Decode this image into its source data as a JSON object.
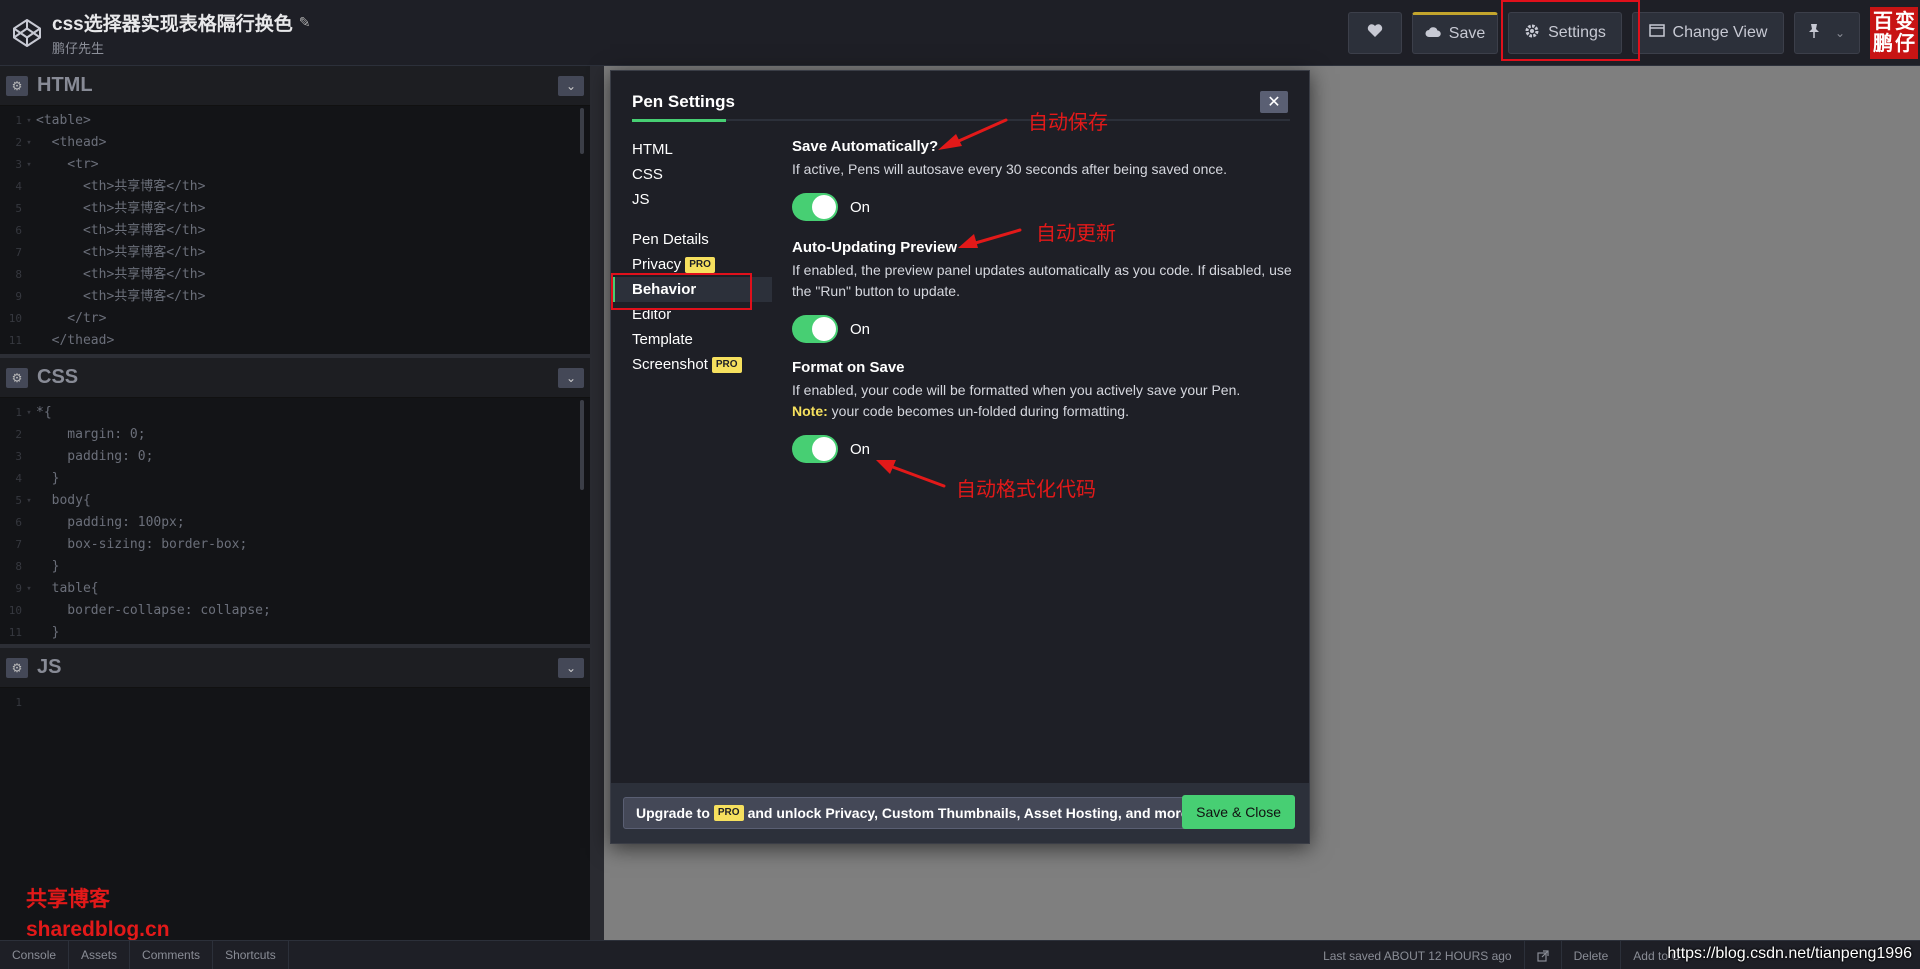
{
  "header": {
    "pen_title": "css选择器实现表格隔行换色",
    "author": "鹏仔先生",
    "save_label": "Save",
    "settings_label": "Settings",
    "change_view_label": "Change View",
    "avatar_chars": [
      "百",
      "变",
      "鹏",
      "仔"
    ]
  },
  "editors": {
    "html": {
      "label": "HTML",
      "lines": [
        {
          "n": "1",
          "fold": "▾",
          "text": "<table>"
        },
        {
          "n": "2",
          "fold": "▾",
          "text": "  <thead>"
        },
        {
          "n": "3",
          "fold": "▾",
          "text": "    <tr>"
        },
        {
          "n": "4",
          "fold": "",
          "text": "      <th>共享博客</th>"
        },
        {
          "n": "5",
          "fold": "",
          "text": "      <th>共享博客</th>"
        },
        {
          "n": "6",
          "fold": "",
          "text": "      <th>共享博客</th>"
        },
        {
          "n": "7",
          "fold": "",
          "text": "      <th>共享博客</th>"
        },
        {
          "n": "8",
          "fold": "",
          "text": "      <th>共享博客</th>"
        },
        {
          "n": "9",
          "fold": "",
          "text": "      <th>共享博客</th>"
        },
        {
          "n": "10",
          "fold": "",
          "text": "    </tr>"
        },
        {
          "n": "11",
          "fold": "",
          "text": "  </thead>"
        }
      ]
    },
    "css": {
      "label": "CSS",
      "lines": [
        {
          "n": "1",
          "fold": "▾",
          "text": "*{"
        },
        {
          "n": "2",
          "fold": "",
          "text": "    margin: 0;"
        },
        {
          "n": "3",
          "fold": "",
          "text": "    padding: 0;"
        },
        {
          "n": "4",
          "fold": "",
          "text": "  }"
        },
        {
          "n": "5",
          "fold": "▾",
          "text": "  body{"
        },
        {
          "n": "6",
          "fold": "",
          "text": "    padding: 100px;"
        },
        {
          "n": "7",
          "fold": "",
          "text": "    box-sizing: border-box;"
        },
        {
          "n": "8",
          "fold": "",
          "text": "  }"
        },
        {
          "n": "9",
          "fold": "▾",
          "text": "  table{"
        },
        {
          "n": "10",
          "fold": "",
          "text": "    border-collapse: collapse;"
        },
        {
          "n": "11",
          "fold": "",
          "text": "  }"
        }
      ]
    },
    "js": {
      "label": "JS",
      "lines": [
        {
          "n": "1",
          "fold": "",
          "text": ""
        }
      ]
    }
  },
  "watermark": {
    "line1": "共享博客",
    "line2": "sharedblog.cn"
  },
  "modal": {
    "title": "Pen Settings",
    "close_label": "✕",
    "nav": [
      {
        "label": "HTML",
        "pro": false
      },
      {
        "label": "CSS",
        "pro": false
      },
      {
        "label": "JS",
        "pro": false
      },
      {
        "label": "Pen Details",
        "pro": false
      },
      {
        "label": "Privacy",
        "pro": true
      },
      {
        "label": "Behavior",
        "pro": false,
        "active": true
      },
      {
        "label": "Editor",
        "pro": false
      },
      {
        "label": "Template",
        "pro": false
      },
      {
        "label": "Screenshot",
        "pro": true
      }
    ],
    "pro_badge": "PRO",
    "settings": [
      {
        "title": "Save Automatically?",
        "desc": "If active, Pens will autosave every 30 seconds after being saved once.",
        "toggle_label": "On",
        "on": true
      },
      {
        "title": "Auto-Updating Preview",
        "desc": "If enabled, the preview panel updates automatically as you code. If disabled, use the \"Run\" button to update.",
        "toggle_label": "On",
        "on": true
      },
      {
        "title": "Format on Save",
        "desc": "If enabled, your code will be formatted when you actively save your Pen.",
        "note_label": "Note:",
        "note_text": " your code becomes un-folded during formatting.",
        "toggle_label": "On",
        "on": true
      }
    ],
    "footer": {
      "upgrade_prefix": "Upgrade to",
      "upgrade_suffix": "and unlock Privacy, Custom Thumbnails, Asset Hosting, and more.",
      "save_close_label": "Save & Close"
    }
  },
  "annotations": {
    "auto_save": "自动保存",
    "auto_update": "自动更新",
    "auto_format": "自动格式化代码",
    "color": "#e21919"
  },
  "bottombar": {
    "left": [
      "Console",
      "Assets",
      "Comments",
      "Shortcuts"
    ],
    "last_saved": "Last saved ABOUT 12 HOURS ago",
    "delete_label": "Delete",
    "add_to_label": "Add to C",
    "csdn_url": "https://blog.csdn.net/tianpeng1996"
  },
  "colors": {
    "accent_green": "#47cf73",
    "pro_yellow": "#f6e05e",
    "highlight_red": "#e0101b"
  }
}
